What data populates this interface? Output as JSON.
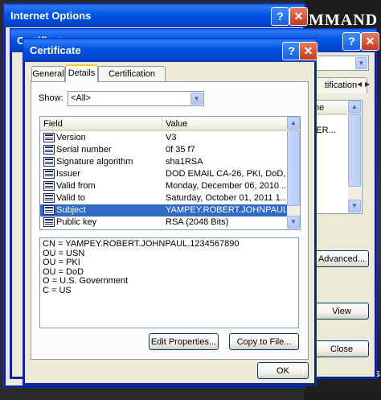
{
  "background": {
    "brand_text": "MMAND",
    "brand_bottom": "U.S"
  },
  "internet_options": {
    "title": "Internet Options",
    "help_label": "?",
    "close_label": "✕"
  },
  "certificates": {
    "title": "Certificates",
    "help_label": "?",
    "close_label": "✕",
    "partial_tab": "tification",
    "partial_col_header": "me",
    "partial_rows": [
      "BER...",
      "e"
    ],
    "advanced_button": "Advanced...",
    "view_button": "View",
    "close_button": "Close"
  },
  "certificate": {
    "title": "Certificate",
    "help_label": "?",
    "close_label": "✕",
    "tabs": [
      {
        "label": "General",
        "active": false
      },
      {
        "label": "Details",
        "active": true
      },
      {
        "label": "Certification Path",
        "active": false
      }
    ],
    "show_label": "Show:",
    "show_value": "<All>",
    "list_headers": {
      "field": "Field",
      "value": "Value"
    },
    "rows": [
      {
        "field": "Version",
        "value": "V3",
        "selected": false
      },
      {
        "field": "Serial number",
        "value": "0f 35 f7",
        "selected": false
      },
      {
        "field": "Signature algorithm",
        "value": "sha1RSA",
        "selected": false
      },
      {
        "field": "Issuer",
        "value": "DOD EMAIL CA-26, PKI, DoD, ...",
        "selected": false
      },
      {
        "field": "Valid from",
        "value": "Monday, December 06, 2010 ...",
        "selected": false
      },
      {
        "field": "Valid to",
        "value": "Saturday, October 01, 2011 1...",
        "selected": false
      },
      {
        "field": "Subject",
        "value": "YAMPEY.ROBERT.JOHNPAUL....",
        "selected": true
      },
      {
        "field": "Public key",
        "value": "RSA (2048 Bits)",
        "selected": false
      }
    ],
    "detail_lines": [
      "CN = YAMPEY.ROBERT.JOHNPAUL.1234567890",
      "OU = USN",
      "OU = PKI",
      "OU = DoD",
      "O = U.S. Government",
      "C = US"
    ],
    "edit_properties_button": "Edit Properties...",
    "copy_to_file_button": "Copy to File...",
    "ok_button": "OK"
  },
  "icons": {
    "scroll_up": "▲",
    "scroll_down": "▼",
    "dropdown": "▼"
  }
}
